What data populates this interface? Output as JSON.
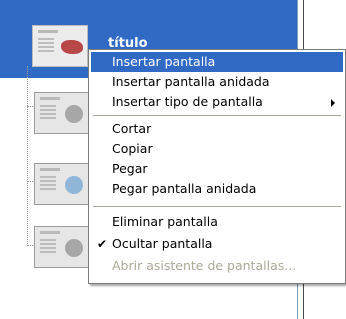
{
  "tree": {
    "selected_row": {
      "title": "título"
    }
  },
  "context_menu": {
    "items": [
      {
        "label": "Insertar pantalla"
      },
      {
        "label": "Insertar pantalla anidada"
      },
      {
        "label": "Insertar tipo de pantalla",
        "submenu_icon": "submenu-arrow-icon"
      },
      {
        "label": "Cortar"
      },
      {
        "label": "Copiar"
      },
      {
        "label": "Pegar"
      },
      {
        "label": "Pegar pantalla anidada"
      },
      {
        "label": "Eliminar pantalla"
      },
      {
        "label": "Ocultar pantalla",
        "checked": true,
        "check_glyph": "✔"
      },
      {
        "label": "Abrir asistente de pantallas...",
        "disabled": true
      }
    ]
  },
  "colors": {
    "selection": "#316ac5",
    "disabled_text": "#aca899",
    "menu_border": "#7b7b7b"
  }
}
